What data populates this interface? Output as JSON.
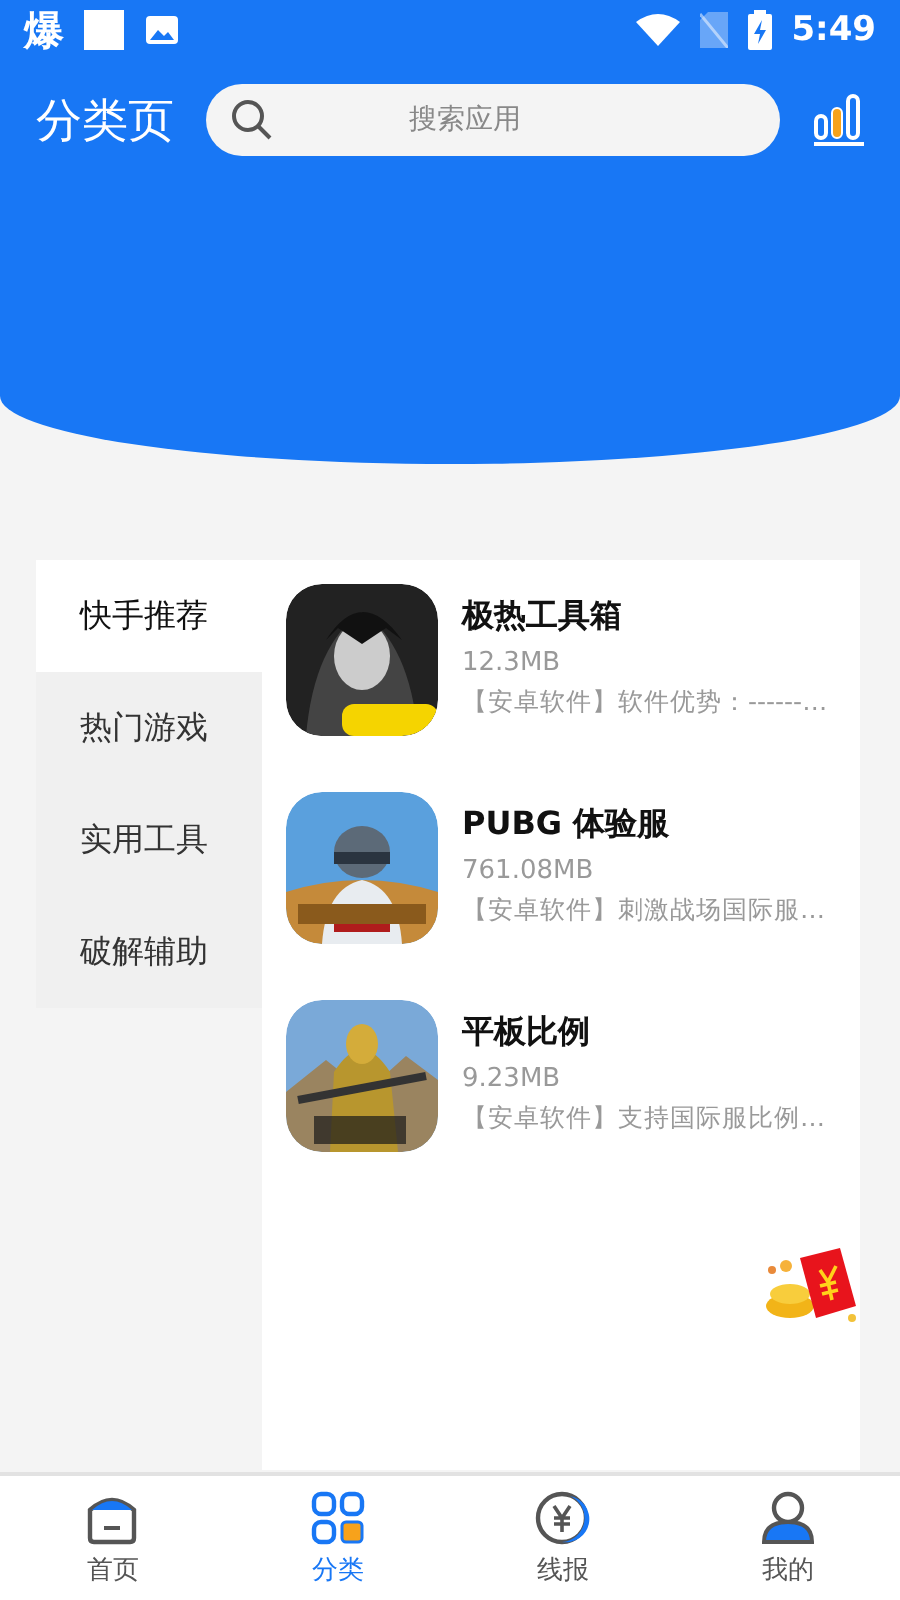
{
  "status_bar": {
    "app_glyph": "爆",
    "time": "5:49"
  },
  "header": {
    "title": "分类页",
    "search": {
      "placeholder": "搜索应用"
    }
  },
  "categories": [
    {
      "label": "快手推荐",
      "selected": true
    },
    {
      "label": "热门游戏",
      "selected": false
    },
    {
      "label": "实用工具",
      "selected": false
    },
    {
      "label": "破解辅助",
      "selected": false
    }
  ],
  "apps": [
    {
      "name": "极热工具箱",
      "size": "12.3MB",
      "description": "【安卓软件】软件优势：------…"
    },
    {
      "name": "PUBG 体验服",
      "size": "761.08MB",
      "description": "【安卓软件】刺激战场国际服…"
    },
    {
      "name": "平板比例",
      "size": "9.23MB",
      "description": "【安卓软件】支持国际服比例…"
    }
  ],
  "tabs": [
    {
      "label": "首页",
      "selected": false
    },
    {
      "label": "分类",
      "selected": true
    },
    {
      "label": "线报",
      "selected": false
    },
    {
      "label": "我的",
      "selected": false
    }
  ]
}
